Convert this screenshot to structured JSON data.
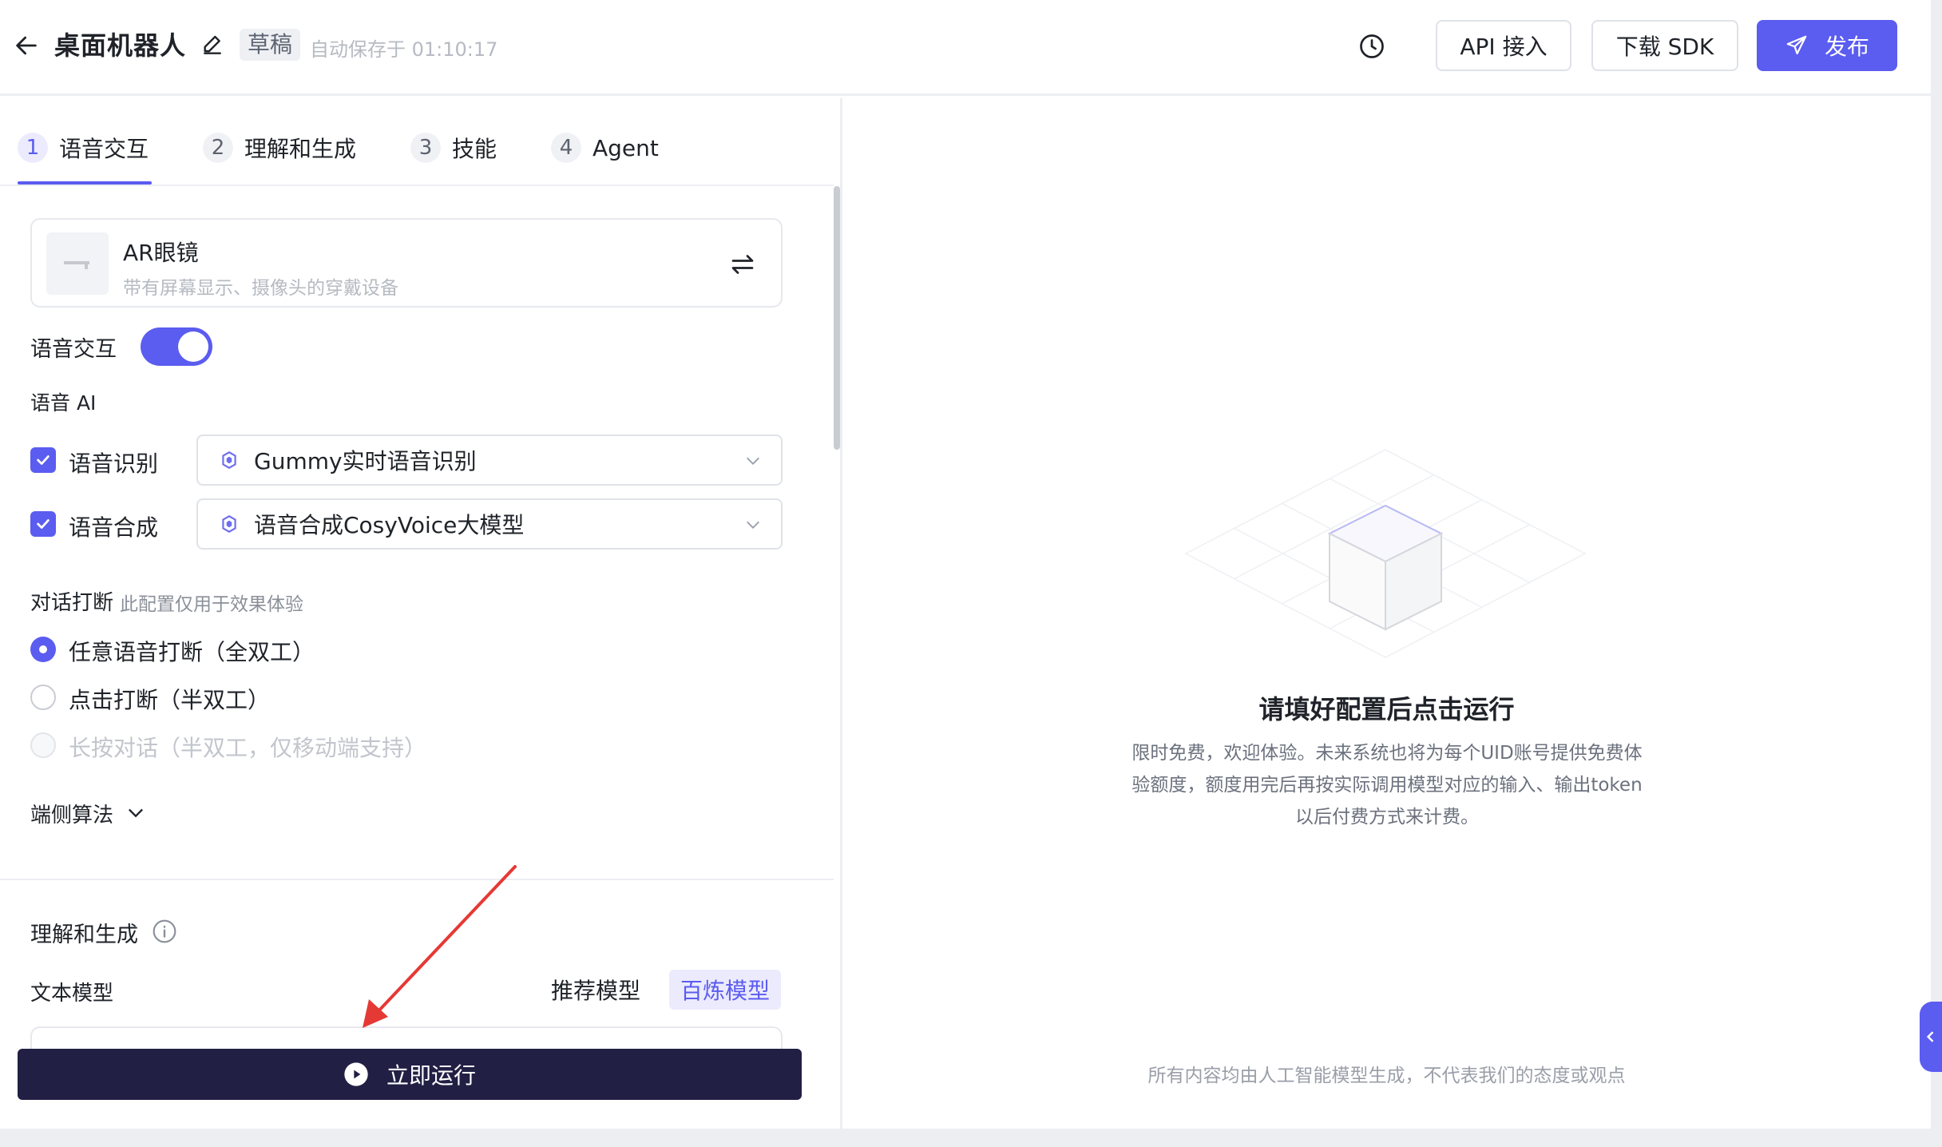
{
  "header": {
    "title": "桌面机器人",
    "draft_label": "草稿",
    "autosave_text": "自动保存于 01:10:17",
    "api_button": "API 接入",
    "sdk_button": "下载 SDK",
    "publish_button": "发布"
  },
  "tabs": [
    {
      "num": "1",
      "label": "语音交互"
    },
    {
      "num": "2",
      "label": "理解和生成"
    },
    {
      "num": "3",
      "label": "技能"
    },
    {
      "num": "4",
      "label": "Agent"
    }
  ],
  "device": {
    "name": "AR眼镜",
    "description": "带有屏幕显示、摄像头的穿戴设备"
  },
  "voice": {
    "toggle_label": "语音交互",
    "toggle_on": true,
    "ai_section_label": "语音 AI",
    "asr_label": "语音识别",
    "asr_model": "Gummy实时语音识别",
    "tts_label": "语音合成",
    "tts_model": "语音合成CosyVoice大模型"
  },
  "interrupt": {
    "title": "对话打断",
    "note": "此配置仅用于效果体验",
    "options": [
      {
        "label": "任意语音打断（全双工）",
        "checked": true
      },
      {
        "label": "点击打断（半双工）",
        "checked": false
      },
      {
        "label": "长按对话（半双工，仅移动端支持）",
        "disabled": true
      }
    ]
  },
  "device_algo_label": "端侧算法",
  "understand": {
    "title": "理解和生成",
    "text_model_label": "文本模型",
    "recommend_label": "推荐模型",
    "bailian_label": "百炼模型"
  },
  "run_button": "立即运行",
  "right_panel": {
    "empty_title": "请填好配置后点击运行",
    "empty_desc": "限时免费，欢迎体验。未来系统也将为每个UID账号提供免费体验额度，额度用完后再按实际调用模型对应的输入、输出token以后付费方式来计费。",
    "disclaimer": "所有内容均由人工智能模型生成，不代表我们的态度或观点"
  },
  "colors": {
    "accent": "#5b5cf0",
    "run_button_bg": "#221f45",
    "annotation_arrow": "#e53935"
  }
}
